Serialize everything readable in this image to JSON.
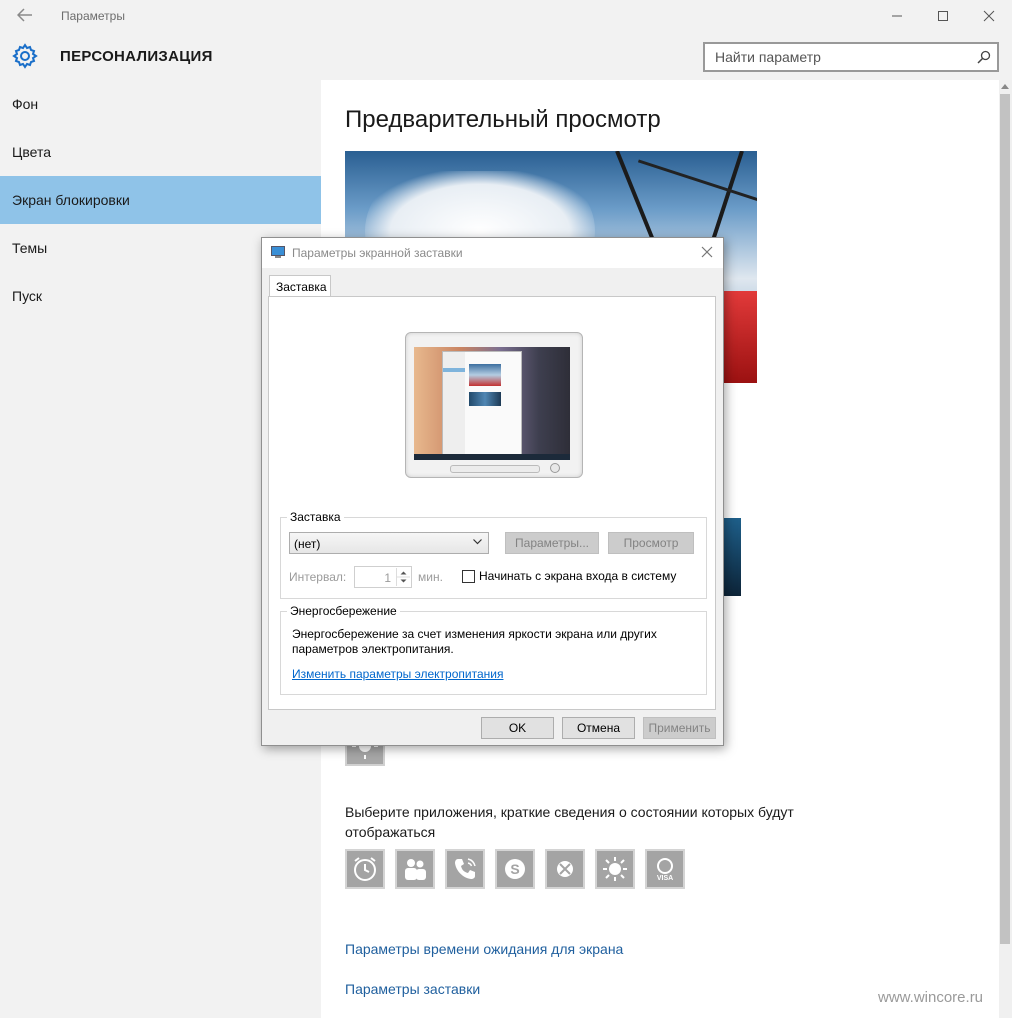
{
  "window": {
    "title": "Параметры",
    "back_icon": "arrow-left-icon"
  },
  "header": {
    "section_title": "ПЕРСОНАЛИЗАЦИЯ",
    "search_placeholder": "Найти параметр"
  },
  "sidebar": {
    "items": [
      {
        "label": "Фон",
        "active": false
      },
      {
        "label": "Цвета",
        "active": false
      },
      {
        "label": "Экран блокировки",
        "active": true
      },
      {
        "label": "Темы",
        "active": false
      },
      {
        "label": "Пуск",
        "active": false
      }
    ]
  },
  "main": {
    "preview_heading": "Предварительный просмотр",
    "apps_text": "Выберите приложения, краткие сведения о состоянии которых будут отображаться",
    "app_icons": [
      "alarm-clock-icon",
      "people-icon",
      "phone-icon",
      "skype-icon",
      "xbox-icon",
      "weather-icon",
      "visa-icon"
    ],
    "links": {
      "timeout": "Параметры времени ожидания для экрана",
      "screensaver": "Параметры заставки"
    },
    "watermark": "www.wincore.ru"
  },
  "dialog": {
    "title": "Параметры экранной заставки",
    "tab": "Заставка",
    "screensaver_group": {
      "legend": "Заставка",
      "selected": "(нет)",
      "settings_button": "Параметры...",
      "preview_button": "Просмотр",
      "interval_label": "Интервал:",
      "interval_value": "1",
      "minutes_label": "мин.",
      "logon_checkbox": "Начинать с экрана входа в систему",
      "logon_checked": false
    },
    "power_group": {
      "legend": "Энергосбережение",
      "description": "Энергосбережение за счет изменения яркости экрана или других параметров электропитания.",
      "link": "Изменить параметры электропитания"
    },
    "buttons": {
      "ok": "OK",
      "cancel": "Отмена",
      "apply": "Применить"
    }
  },
  "colors": {
    "accent": "#8fc3e8",
    "link": "#1f5f9e",
    "sidebar_bg": "#f2f2f2"
  }
}
